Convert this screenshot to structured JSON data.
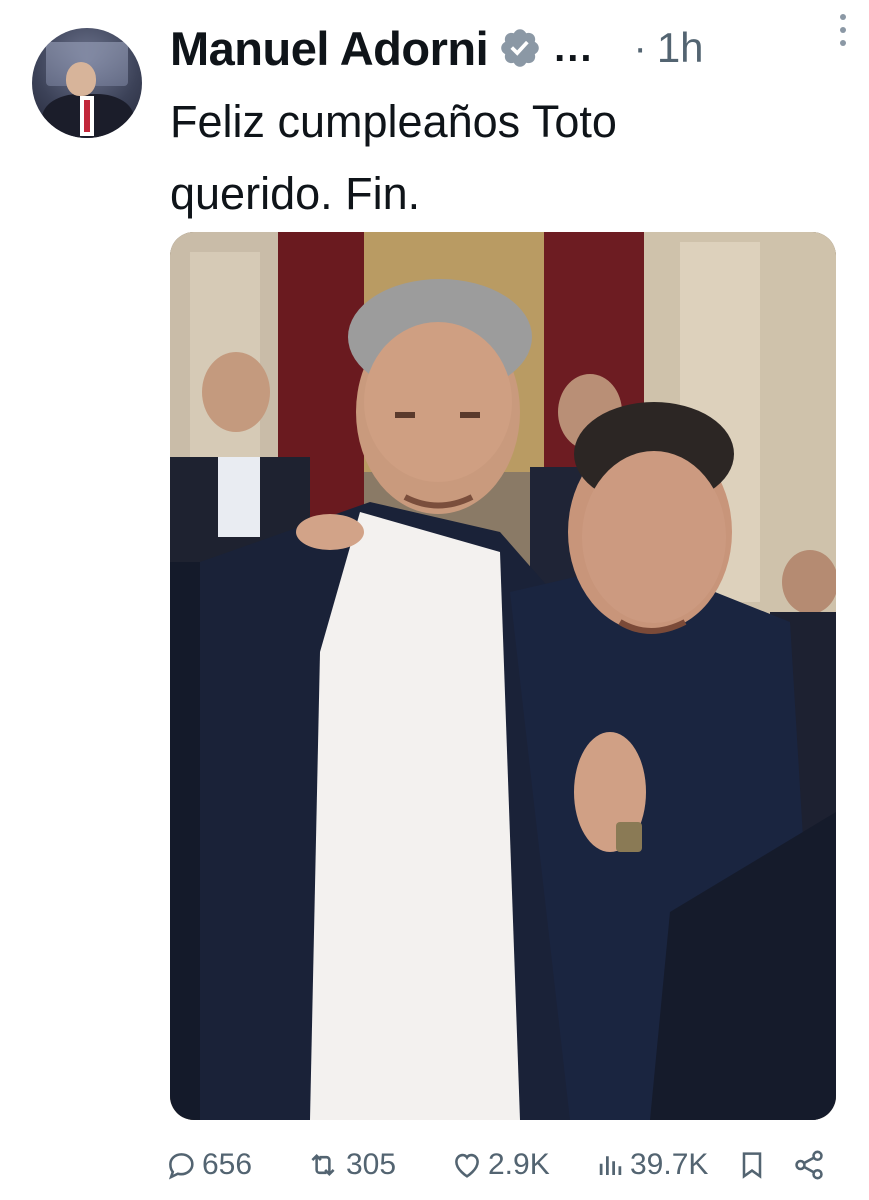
{
  "tweet": {
    "author": {
      "display_name": "Manuel Adorni",
      "name_overflow": "...",
      "verified": true,
      "avatar_icon": "avatar-photo"
    },
    "separator": "·",
    "time": "1h",
    "text": "Feliz cumpleaños Toto\nquerido. Fin.",
    "media": {
      "type": "photo",
      "icon": "photo-image"
    },
    "actions": {
      "replies": "656",
      "reposts": "305",
      "likes": "2.9K",
      "views": "39.7K"
    }
  },
  "icons": {
    "verified": "verified-badge-icon",
    "more": "more-vertical-icon",
    "reply": "reply-icon",
    "repost": "repost-icon",
    "like": "heart-icon",
    "views": "views-icon",
    "bookmark": "bookmark-icon",
    "share": "share-icon"
  },
  "colors": {
    "text_primary": "#0f1419",
    "text_secondary": "#536471",
    "verified_badge": "#8b98a5"
  }
}
